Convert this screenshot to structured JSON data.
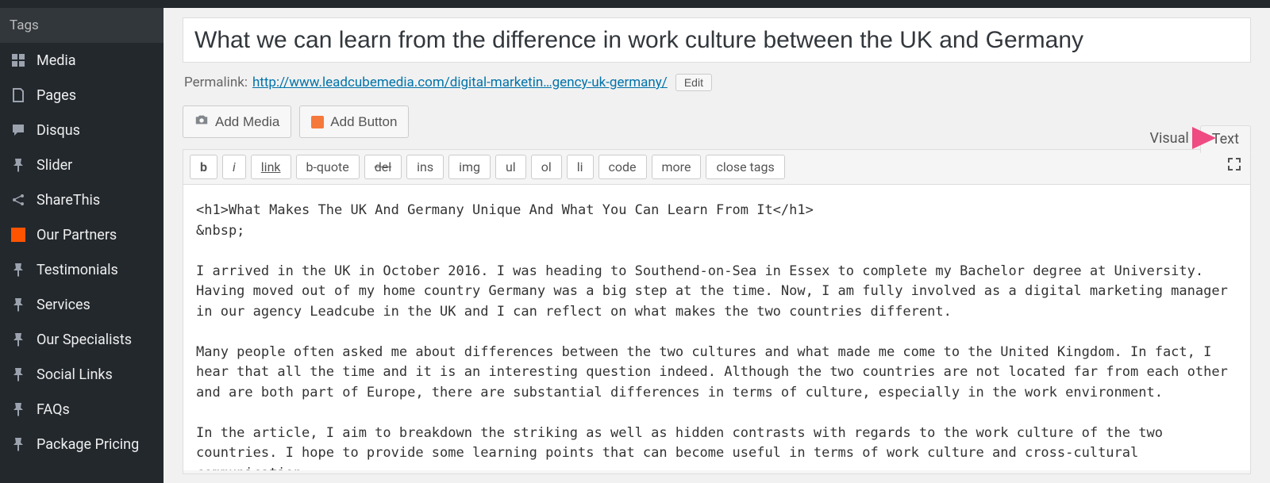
{
  "sidebar": {
    "items": [
      {
        "label": "Tags",
        "icon": null,
        "sub": true
      },
      {
        "label": "Media",
        "icon": "media"
      },
      {
        "label": "Pages",
        "icon": "pages"
      },
      {
        "label": "Disqus",
        "icon": "chat"
      },
      {
        "label": "Slider",
        "icon": "pin"
      },
      {
        "label": "ShareThis",
        "icon": "share"
      },
      {
        "label": "Our Partners",
        "icon": "square"
      },
      {
        "label": "Testimonials",
        "icon": "pin"
      },
      {
        "label": "Services",
        "icon": "pin"
      },
      {
        "label": "Our Specialists",
        "icon": "pin"
      },
      {
        "label": "Social Links",
        "icon": "pin"
      },
      {
        "label": "FAQs",
        "icon": "pin"
      },
      {
        "label": "Package Pricing",
        "icon": "pin"
      }
    ]
  },
  "post": {
    "title": "What we can learn from the difference in work culture between the UK and Germany",
    "permalink_label": "Permalink:",
    "permalink_base": "http://www.leadcubemedia.com/",
    "permalink_slug": "digital-marketin…gency-uk-germany/",
    "edit_label": "Edit"
  },
  "buttons": {
    "add_media": "Add Media",
    "add_button": "Add Button"
  },
  "tabs": {
    "visual": "Visual",
    "text": "Text"
  },
  "toolbar": {
    "b": "b",
    "i": "i",
    "link": "link",
    "bquote": "b-quote",
    "del": "del",
    "ins": "ins",
    "img": "img",
    "ul": "ul",
    "ol": "ol",
    "li": "li",
    "code": "code",
    "more": "more",
    "close": "close tags"
  },
  "editor": {
    "content": "<h1>What Makes The UK And Germany Unique And What You Can Learn From It</h1>\n&nbsp;\n\nI arrived in the UK in October 2016. I was heading to Southend-on-Sea in Essex to complete my Bachelor degree at University. Having moved out of my home country Germany was a big step at the time. Now, I am fully involved as a digital marketing manager in our agency Leadcube in the UK and I can reflect on what makes the two countries different.\n\nMany people often asked me about differences between the two cultures and what made me come to the United Kingdom. In fact, I hear that all the time and it is an interesting question indeed. Although the two countries are not located far from each other and are both part of Europe, there are substantial differences in terms of culture, especially in the work environment.\n\nIn the article, I aim to breakdown the striking as well as hidden contrasts with regards to the work culture of the two countries. I hope to provide some learning points that can become useful in terms of work culture and cross-cultural communication."
  }
}
